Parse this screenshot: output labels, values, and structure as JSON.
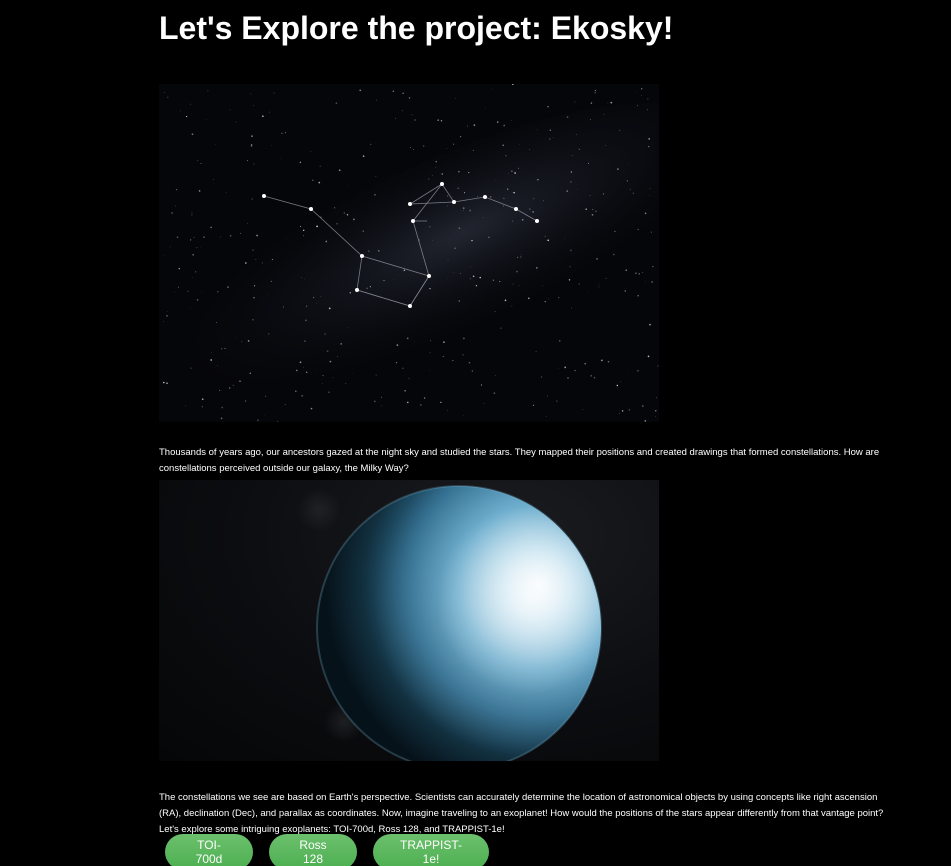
{
  "page": {
    "title": "Let's Explore the project: Ekosky!",
    "paragraph1": "Thousands of years ago, our ancestors gazed at the night sky and studied the stars. They mapped their positions and created drawings that formed constellations. How are constellations perceived outside our galaxy, the Milky Way?",
    "paragraph2": "The constellations we see are based on Earth's perspective. Scientists can accurately determine the location of astronomical objects by using concepts like right ascension (RA), declination (Dec), and parallax as coordinates. Now, imagine traveling to an exoplanet! How would the positions of the stars appear differently from that vantage point? Let's explore some intriguing exoplanets: TOI-700d, Ross 128, and TRAPPIST-1e!"
  },
  "buttons": [
    {
      "label": "TOI-700d"
    },
    {
      "label": "Ross 128"
    },
    {
      "label": "TRAPPIST-1e!"
    }
  ],
  "colors": {
    "background": "#000000",
    "button_green": "#4caf50",
    "text": "#ffffff"
  }
}
